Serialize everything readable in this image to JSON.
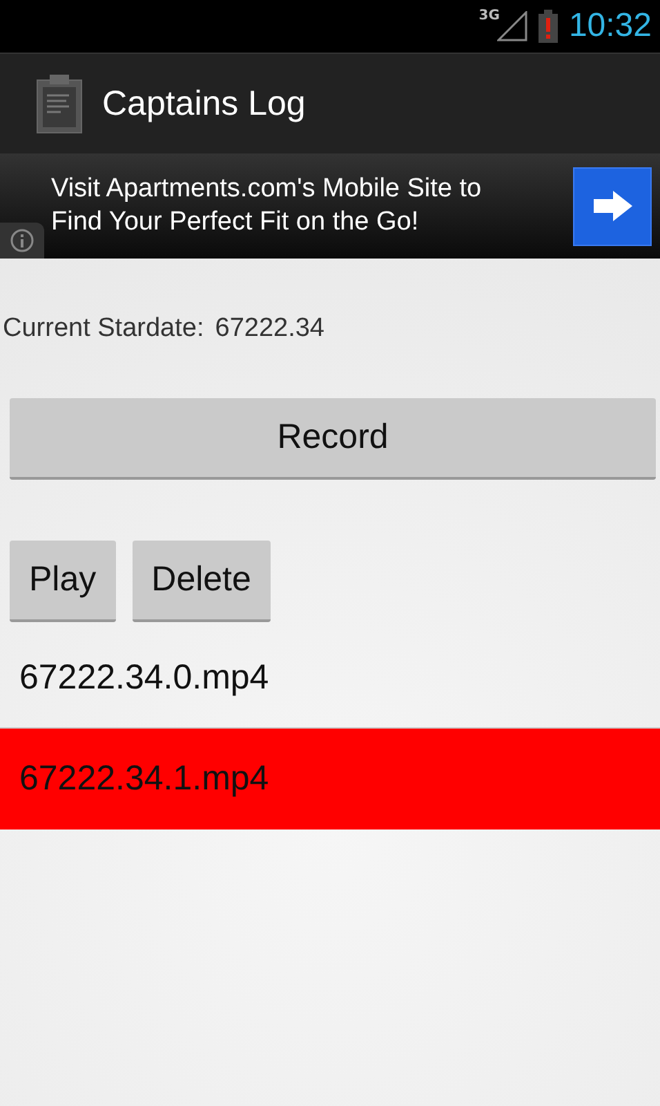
{
  "status_bar": {
    "network": "3G",
    "time": "10:32"
  },
  "app_bar": {
    "title": "Captains Log"
  },
  "ad": {
    "text": "Visit Apartments.com's Mobile Site to Find Your Perfect Fit on the Go!"
  },
  "stardate": {
    "label": "Current Stardate:",
    "value": "67222.34"
  },
  "record_button": "Record",
  "buttons": [
    "Play",
    "Delete"
  ],
  "files": [
    {
      "name": "67222.34.0.mp4",
      "selected": false
    },
    {
      "name": "67222.34.1.mp4",
      "selected": true
    }
  ]
}
